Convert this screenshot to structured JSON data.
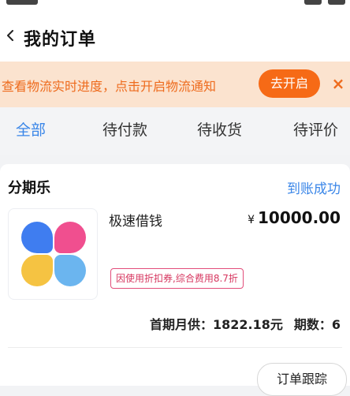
{
  "header": {
    "title": "我的订单"
  },
  "banner": {
    "text": "查看物流实时进度，点击开启物流通知",
    "button_label": "去开启",
    "close_glyph": "×"
  },
  "tabs": [
    {
      "label": "全部",
      "active": true
    },
    {
      "label": "待付款",
      "active": false
    },
    {
      "label": "待收货",
      "active": false
    },
    {
      "label": "待评价",
      "active": false
    }
  ],
  "order": {
    "merchant": "分期乐",
    "status": "到账成功",
    "product_name": "极速借钱",
    "currency_symbol": "¥",
    "price": "10000.00",
    "discount_tag": "因使用折扣券,综合费用8.7折",
    "first_payment": "首期月供：1822.18元",
    "installments": "期数：6",
    "track_button": "订单跟踪"
  },
  "colors": {
    "accent_blue": "#3a86e8",
    "banner_orange": "#f66a16",
    "banner_bg": "#fbe3cf",
    "tag_pink": "#d6365f",
    "logo_blue": "#3f7df0",
    "logo_pink": "#f04f8f",
    "logo_yellow": "#f5c342",
    "logo_lightblue": "#6bb5ef"
  },
  "icons": {
    "back": "chevron-left-icon",
    "close": "close-icon",
    "logo": "four-petal-logo-icon"
  }
}
